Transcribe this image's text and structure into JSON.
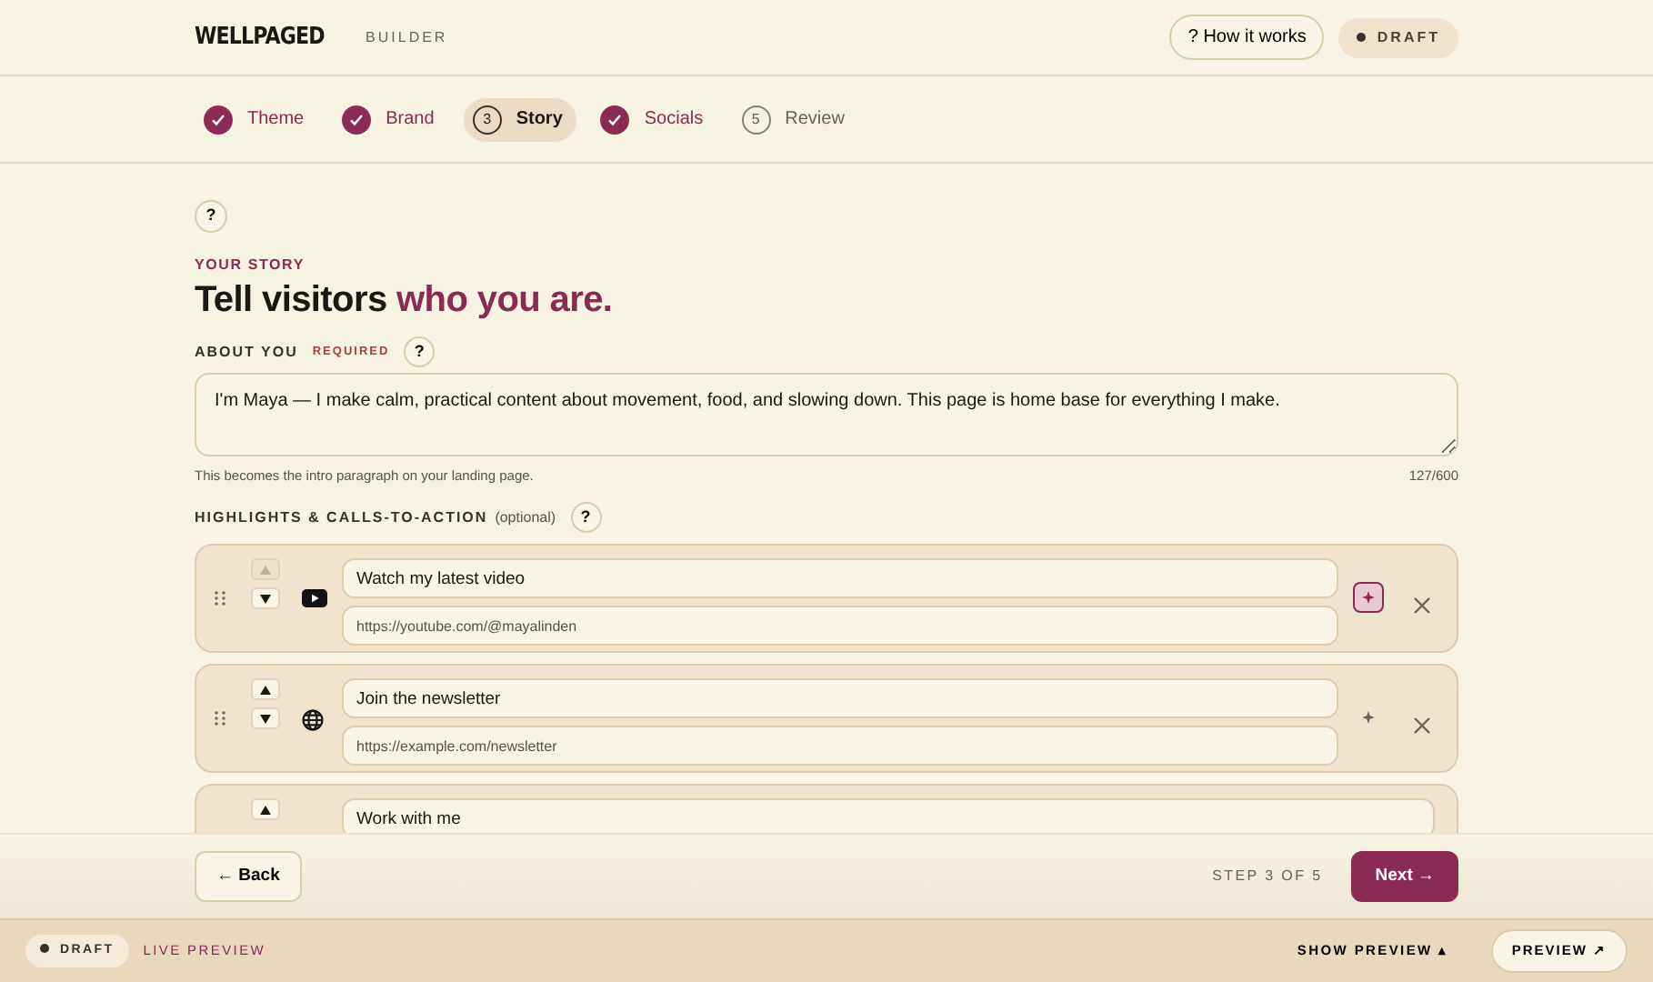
{
  "header": {
    "logo": "WELLPAGED",
    "product": "BUILDER",
    "help_button": "? How it works",
    "status_badge": "DRAFT"
  },
  "steps": [
    {
      "label": "Theme",
      "done": true,
      "selected": false
    },
    {
      "label": "Brand",
      "done": true,
      "selected": false
    },
    {
      "number": "3",
      "label": "Story",
      "done": false,
      "selected": true
    },
    {
      "label": "Socials",
      "done": true,
      "selected": false
    },
    {
      "number": "5",
      "label": "Review",
      "done": false,
      "selected": false
    }
  ],
  "help_icon": "?",
  "eyebrow": "YOUR STORY",
  "heading": "Tell visitors **who you are.**",
  "about": {
    "label": "ABOUT YOU",
    "required": "REQUIRED",
    "help": "?",
    "value": "I'm Maya — I make calm, practical content about movement, food, and slowing down. This page is home base for everything I make.",
    "hint": "This becomes the intro paragraph on your landing page.",
    "count": "127/600"
  },
  "highlights": {
    "label": "HIGHLIGHTS & CALLS-TO-ACTION",
    "optional": "(optional)",
    "help": "?",
    "items": [
      {
        "kind": "youtube",
        "title": "Watch my latest video",
        "url": "https://youtube.com/@mayalinden",
        "up_disabled": true,
        "featured": true
      },
      {
        "kind": "web",
        "title": "Join the newsletter",
        "url": "https://example.com/newsletter",
        "up_disabled": false,
        "featured": false
      },
      {
        "title": "Work with me",
        "up_disabled": false
      }
    ]
  },
  "actions": {
    "back": "← Back",
    "step_text": "STEP 3 OF 5",
    "next": "Next →"
  },
  "bottom_bar": {
    "badge": "DRAFT",
    "live": "LIVE PREVIEW",
    "toggle": "SHOW PREVIEW",
    "toggle_caret": "▴",
    "preview": "PREVIEW ↗"
  }
}
